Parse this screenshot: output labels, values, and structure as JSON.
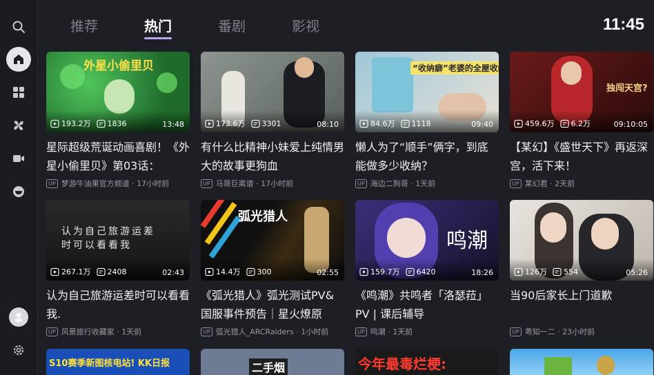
{
  "header": {
    "tabs": [
      {
        "label": "推荐",
        "active": false
      },
      {
        "label": "热门",
        "active": true
      },
      {
        "label": "番剧",
        "active": false
      },
      {
        "label": "影视",
        "active": false
      }
    ],
    "clock": "11:45"
  },
  "sidebar": {
    "items": [
      {
        "icon": "search-icon"
      },
      {
        "icon": "home-icon",
        "active": true
      },
      {
        "icon": "category-grid-icon"
      },
      {
        "icon": "fan-icon"
      },
      {
        "icon": "video-camera-icon"
      },
      {
        "icon": "tv-face-icon"
      },
      {
        "icon": "avatar"
      },
      {
        "icon": "gear-icon"
      }
    ]
  },
  "accent_color": "#b9a6f2",
  "videos": [
    {
      "title": "星际超级荒诞动画喜剧！《外星小偷里贝》第03话：",
      "views": "193.2万",
      "comments": "1836",
      "duration": "13:48",
      "uploader": "梦游牛油果官方频道",
      "time": "17小时前",
      "thumb_text": "外星小偷里贝"
    },
    {
      "title": "有什么比精神小妹爱上纯情男大的故事更狗血",
      "views": "173.6万",
      "comments": "3301",
      "duration": "08:10",
      "uploader": "马哥巨离谱",
      "time": "17小时前",
      "thumb_text": ""
    },
    {
      "title": "懒人为了“顺手”俩字，到底能做多少收纳？",
      "views": "84.6万",
      "comments": "1118",
      "duration": "09:40",
      "uploader": "海边二狗哥",
      "time": "1天前",
      "thumb_text": "“收纳癖”老婆的全屋收纳"
    },
    {
      "title": "【某幻】《盛世天下》再返深宫，活下来！",
      "views": "459.6万",
      "comments": "6.2万",
      "duration": "09:10:05",
      "uploader": "某幻君",
      "time": "2天前",
      "thumb_text": "独闯天宫?"
    },
    {
      "title": "认为自己旅游运差时可以看看我.",
      "views": "267.1万",
      "comments": "2408",
      "duration": "02:43",
      "uploader": "风景旅行收藏家",
      "time": "1天前",
      "thumb_text": "认为自己旅游运差时可以看看我"
    },
    {
      "title": "《弧光猎人》弧光测试PV&国服事件预告｜星火燎原",
      "views": "14.4万",
      "comments": "300",
      "duration": "02:55",
      "uploader": "弧光猎人_ARCRaiders",
      "time": "1小时前",
      "thumb_text": "弧光猎人"
    },
    {
      "title": "《鸣潮》共鸣者「洛瑟菈」PV | 课后辅导",
      "views": "159.7万",
      "comments": "6420",
      "duration": "18:26",
      "uploader": "鸣潮",
      "time": "1天前",
      "thumb_text": "鸣潮"
    },
    {
      "title": "当90后家长上门道歉",
      "views": "126万",
      "comments": "554",
      "duration": "05:26",
      "uploader": "粤知一二",
      "time": "23小时前",
      "thumb_text": ""
    }
  ],
  "partial_row": [
    {
      "thumb_text": "S10赛季新图核电站! KK日报"
    },
    {
      "thumb_text": "二手烟"
    },
    {
      "thumb_text": "今年最毒烂梗:"
    },
    {
      "thumb_text": ""
    }
  ]
}
